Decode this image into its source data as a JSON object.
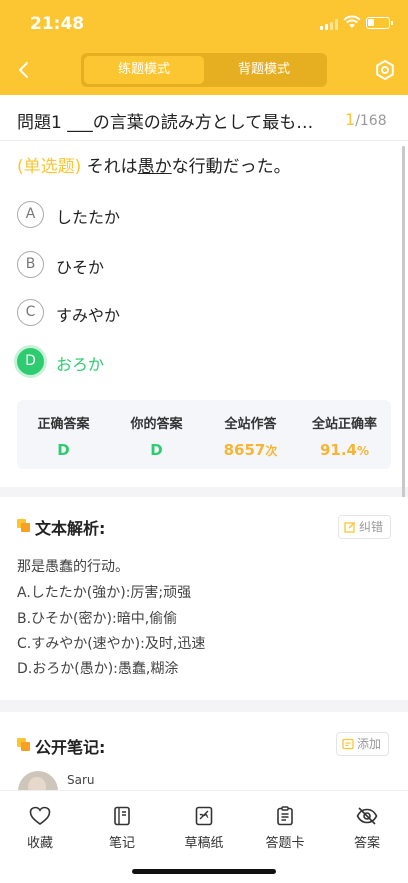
{
  "status_bar": {
    "time": "21:48"
  },
  "header": {
    "back_icon": "chevron-left-icon",
    "settings_icon": "gear-icon",
    "modes": [
      "练题模式",
      "背题模式"
    ],
    "active_mode_index": 0,
    "accent_color": "#fcc633"
  },
  "question_header": {
    "title": "問題1 ___の言葉の読み方として最も…",
    "current": "1",
    "total": "/168"
  },
  "question": {
    "type": "(单选题)",
    "text_before": " それは",
    "underlined": "愚か",
    "text_after": "な行動だった。"
  },
  "options": [
    {
      "letter": "A",
      "text": "したたか",
      "correct": false
    },
    {
      "letter": "B",
      "text": "ひそか",
      "correct": false
    },
    {
      "letter": "C",
      "text": "すみやか",
      "correct": false
    },
    {
      "letter": "D",
      "text": "おろか",
      "correct": true
    }
  ],
  "stats": {
    "correct_answer_label": "正确答案",
    "correct_answer": "D",
    "your_answer_label": "你的答案",
    "your_answer": "D",
    "site_answers_label": "全站作答",
    "site_answers": "8657",
    "site_answers_unit": "次",
    "site_accuracy_label": "全站正确率",
    "site_accuracy": "91.4",
    "site_accuracy_unit": "%",
    "correct_color": "#2ecc71",
    "stat_color": "#f8b535"
  },
  "analysis": {
    "title": "文本解析:",
    "correct_button": "纠错",
    "lines": [
      "那是愚蠢的行动。",
      "A.したたか(強か):厉害;顽强",
      "B.ひそか(密か):暗中,偷偷",
      "C.すみやか(速やか):及时,迅速",
      "D.おろか(愚か):愚蠢,糊涂"
    ]
  },
  "notes": {
    "title": "公开笔记:",
    "add_button": "添加",
    "first_user": "Saru"
  },
  "tabbar": [
    {
      "label": "收藏",
      "icon": "heart-icon"
    },
    {
      "label": "笔记",
      "icon": "notebook-icon"
    },
    {
      "label": "草稿纸",
      "icon": "draft-paper-icon"
    },
    {
      "label": "答题卡",
      "icon": "answer-sheet-icon"
    },
    {
      "label": "答案",
      "icon": "eye-hidden-icon"
    }
  ]
}
